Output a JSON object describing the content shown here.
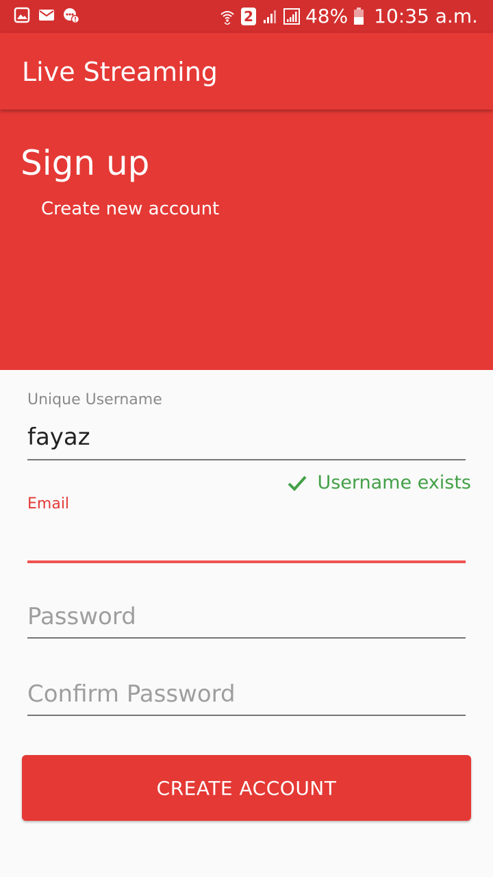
{
  "status_bar": {
    "icons_left": [
      "gallery-icon",
      "mail-icon",
      "chat-alert-icon"
    ],
    "icons_right": [
      "wifi-icon",
      "sim2-badge-icon",
      "signal-icon",
      "signal-icon-2",
      "battery-icon"
    ],
    "sim_badge": "2",
    "battery": "48%",
    "time": "10:35 a.m."
  },
  "app_bar": {
    "title": "Live Streaming"
  },
  "header": {
    "title": "Sign up",
    "subtitle": "Create new account"
  },
  "form": {
    "username": {
      "label": "Unique Username",
      "value": "fayaz",
      "helper": "Username exists"
    },
    "email": {
      "label": "Email",
      "value": ""
    },
    "password": {
      "placeholder": "Password"
    },
    "confirm_password": {
      "placeholder": "Confirm Password"
    },
    "submit_label": "CREATE ACCOUNT"
  },
  "colors": {
    "primary": "#e53935",
    "status_bar": "#d32f2f",
    "success": "#43a047",
    "error_accent": "#ef5350"
  }
}
